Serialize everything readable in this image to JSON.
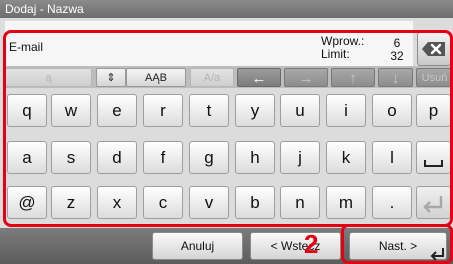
{
  "window": {
    "title": "Dodaj - Nazwa"
  },
  "input": {
    "label": "E-mail",
    "entered_label": "Wprow.:",
    "limit_label": "Limit:",
    "entered_value": "6",
    "limit_value": "32"
  },
  "toolbar": {
    "icon": "ą",
    "alt_icon": "ą",
    "case_label": "AĄB",
    "abc_label": "A/a",
    "delete_label": "Usuń"
  },
  "keyboard": {
    "row1": [
      "q",
      "w",
      "e",
      "r",
      "t",
      "y",
      "u",
      "i",
      "o",
      "p"
    ],
    "row2": [
      "a",
      "s",
      "d",
      "f",
      "g",
      "h",
      "j",
      "k",
      "l"
    ],
    "row3": [
      "@",
      "z",
      "x",
      "c",
      "v",
      "b",
      "n",
      "m",
      "."
    ]
  },
  "footer": {
    "cancel_label": "Anuluj",
    "back_label": "< Wstecz",
    "next_label": "Nast. >"
  },
  "callout": {
    "number": "2"
  },
  "colors": {
    "highlight": "#e50012"
  }
}
